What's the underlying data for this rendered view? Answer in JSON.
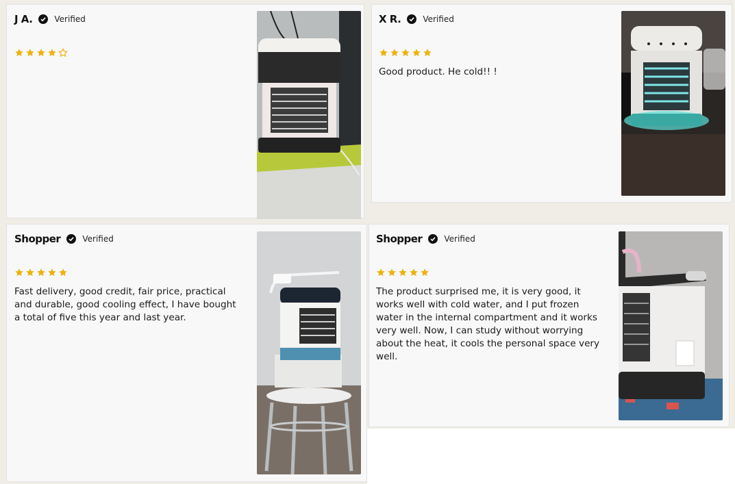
{
  "colors": {
    "star": "#efb10e",
    "badge": "#111111",
    "card": "#f8f8f8"
  },
  "reviews": [
    {
      "name": "J A.",
      "verified": "Verified",
      "rating": 4,
      "text": "",
      "photo": "air-cooler-photo"
    },
    {
      "name": "X R.",
      "verified": "Verified",
      "rating": 5,
      "text": "Good product. He  cold!! !",
      "photo": "air-cooler-photo"
    },
    {
      "name": "Shopper",
      "verified": "Verified",
      "rating": 5,
      "text": "Fast delivery, good credit, fair price, practical and durable, good cooling effect, I have bought a total of five this year and last year.",
      "photo": "air-cooler-photo"
    },
    {
      "name": "Shopper",
      "verified": "Verified",
      "rating": 5,
      "text": "The product surprised me, it is very good, it works well with cold water, and I put frozen water in the internal compartment and it works very well. Now, I can study without worrying about the heat, it cools the personal space very well.",
      "photo": "air-cooler-photo"
    }
  ]
}
